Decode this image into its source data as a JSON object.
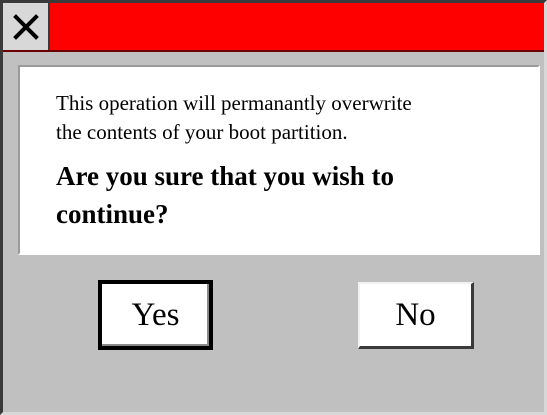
{
  "dialog": {
    "close_icon": "close-x-icon",
    "message_lines": [
      "This operation will permanantly overwrite",
      "the contents of your boot partition."
    ],
    "question": "Are you sure that you wish to continue?",
    "yes_label": "Yes",
    "no_label": "No"
  },
  "colors": {
    "titlebar": "#ff0000",
    "window_background": "#c0c0c0",
    "message_background": "#ffffff"
  }
}
